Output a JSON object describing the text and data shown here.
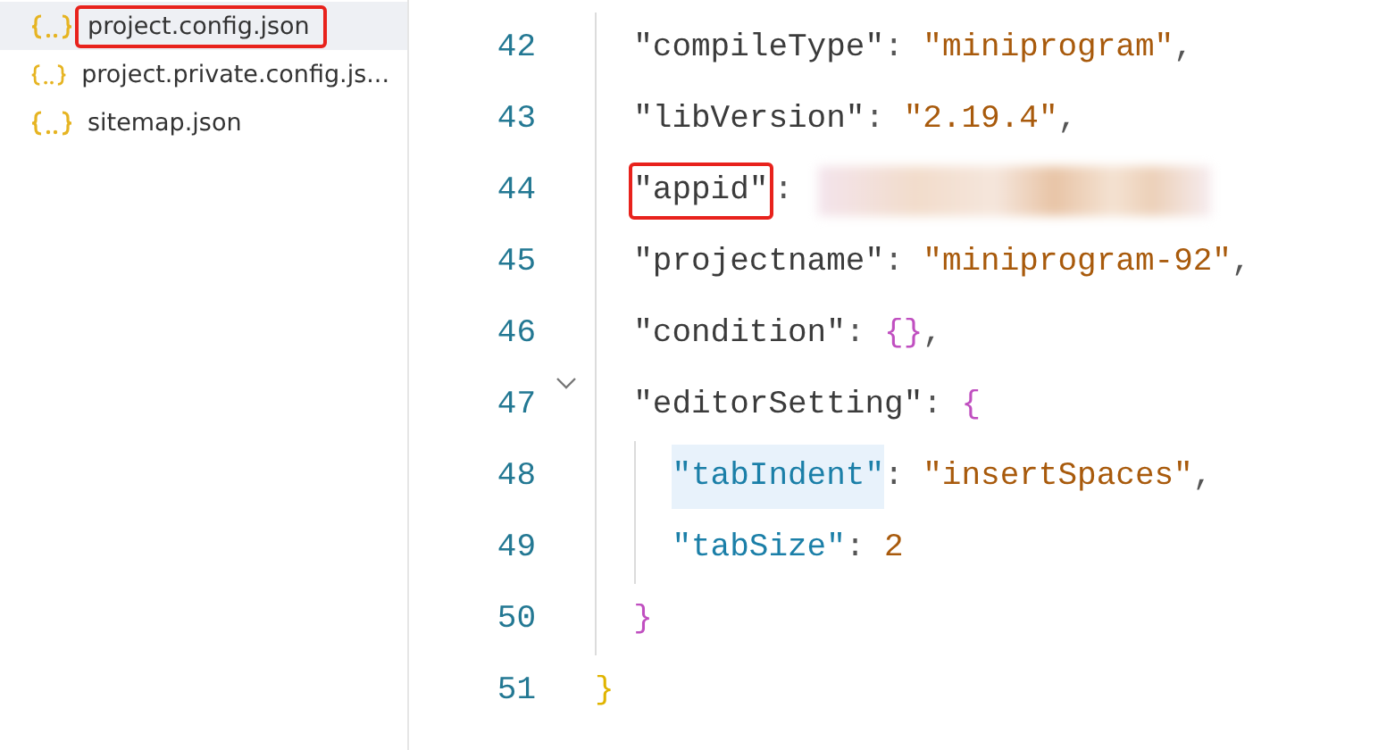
{
  "files": [
    {
      "name": "project.config.json",
      "selected": true,
      "marked": true
    },
    {
      "name": "project.private.config.js...",
      "selected": false,
      "marked": false
    },
    {
      "name": "sitemap.json",
      "selected": false,
      "marked": false
    }
  ],
  "lines": [
    {
      "children": [
        {
          "number": "42",
          "tokens": [
            {
              "kind": "key",
              "text": "\"compileType\""
            },
            {
              "kind": "punct",
              "text": ": "
            },
            {
              "kind": "string",
              "text": "\"miniprogram\""
            },
            {
              "kind": "punct",
              "text": ","
            }
          ]
        },
        {
          "number": "43",
          "tokens": [
            {
              "kind": "key",
              "text": "\"libVersion\""
            },
            {
              "kind": "punct",
              "text": ": "
            },
            {
              "kind": "string",
              "text": "\"2.19.4\""
            },
            {
              "kind": "punct",
              "text": ","
            }
          ]
        },
        {
          "number": "44",
          "redacted": true,
          "tokens": [
            {
              "kind": "key",
              "text": "\"appid\"",
              "marked": true
            },
            {
              "kind": "punct",
              "text": ":"
            }
          ]
        },
        {
          "number": "45",
          "tokens": [
            {
              "kind": "key",
              "text": "\"projectname\""
            },
            {
              "kind": "punct",
              "text": ": "
            },
            {
              "kind": "string",
              "text": "\"miniprogram-92\""
            },
            {
              "kind": "punct",
              "text": ","
            }
          ]
        },
        {
          "number": "46",
          "tokens": [
            {
              "kind": "key",
              "text": "\"condition\""
            },
            {
              "kind": "punct",
              "text": ": "
            },
            {
              "kind": "brace2",
              "text": "{}"
            },
            {
              "kind": "punct",
              "text": ","
            }
          ]
        },
        {
          "number": "47",
          "foldable": true,
          "tokens": [
            {
              "kind": "key",
              "text": "\"editorSetting\""
            },
            {
              "kind": "punct",
              "text": ": "
            },
            {
              "kind": "brace2",
              "text": "{"
            }
          ],
          "children": [
            {
              "number": "48",
              "tokens": [
                {
                  "kind": "key2",
                  "text": "\"tabIndent\"",
                  "highlighted": true
                },
                {
                  "kind": "punct",
                  "text": ": "
                },
                {
                  "kind": "string",
                  "text": "\"insertSpaces\""
                },
                {
                  "kind": "punct",
                  "text": ","
                }
              ]
            },
            {
              "number": "49",
              "tokens": [
                {
                  "kind": "key2",
                  "text": "\"tabSize\""
                },
                {
                  "kind": "punct",
                  "text": ": "
                },
                {
                  "kind": "number",
                  "text": "2"
                }
              ]
            }
          ]
        },
        {
          "number": "50",
          "tokens": [
            {
              "kind": "brace2",
              "text": "}"
            }
          ]
        }
      ]
    },
    {
      "number": "51",
      "tokens": [
        {
          "kind": "brace1",
          "text": "}"
        }
      ]
    }
  ]
}
